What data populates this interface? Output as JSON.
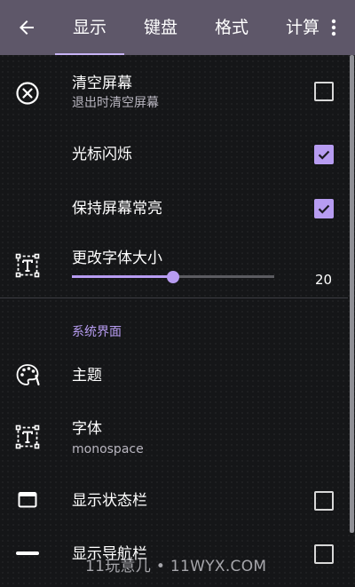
{
  "toolbar": {
    "back_icon": "arrow-left-icon",
    "more_icon": "dots-vertical-icon",
    "tabs": [
      {
        "label": "显示",
        "active": true
      },
      {
        "label": "键盘",
        "active": false
      },
      {
        "label": "格式",
        "active": false
      },
      {
        "label": "计算",
        "active": false
      }
    ]
  },
  "settings": {
    "clear_screen": {
      "title": "清空屏幕",
      "subtitle": "退出时清空屏幕",
      "checked": false,
      "icon": "close-circle-icon"
    },
    "cursor_blink": {
      "title": "光标闪烁",
      "checked": true
    },
    "keep_screen_on": {
      "title": "保持屏幕常亮",
      "checked": true
    },
    "font_size": {
      "title": "更改字体大小",
      "value": "20",
      "min": 0,
      "max": 40,
      "icon": "format-size-icon"
    },
    "section_system": {
      "title": "系统界面"
    },
    "theme": {
      "title": "主题",
      "icon": "palette-icon"
    },
    "font": {
      "title": "字体",
      "subtitle": "monospace",
      "icon": "format-font-icon"
    },
    "show_status_bar": {
      "title": "显示状态栏",
      "checked": false,
      "icon": "window-icon"
    },
    "show_nav_bar": {
      "title": "显示导航栏",
      "checked": false,
      "icon": "minus-icon"
    }
  },
  "watermark": "11玩意儿 • 11WYX.COM",
  "colors": {
    "toolbar": "#5e5769",
    "accent": "#b79cf1",
    "background": "#151618"
  }
}
